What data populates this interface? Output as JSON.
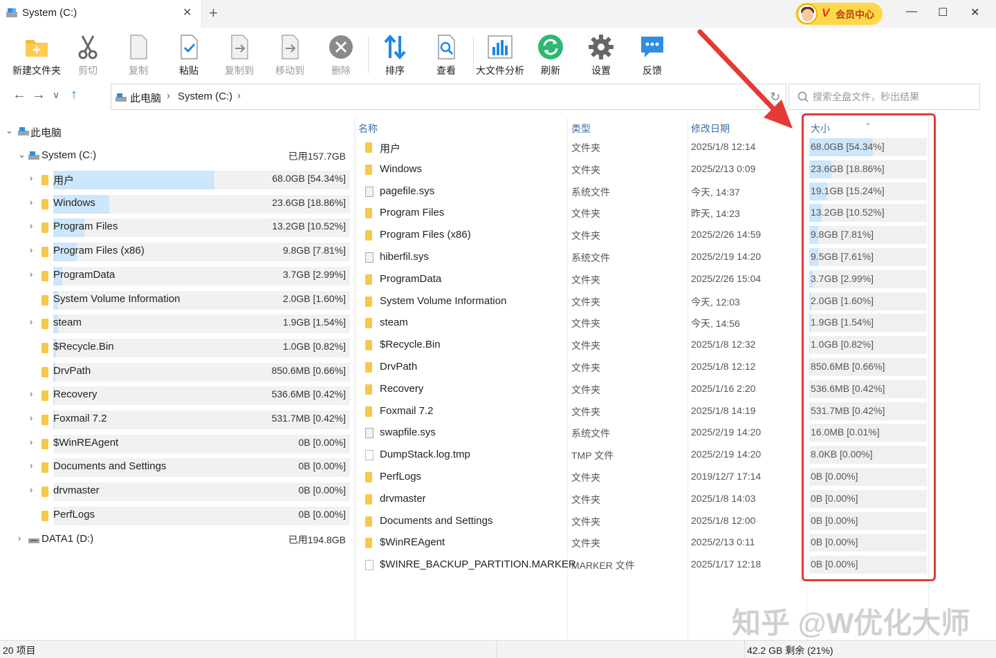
{
  "titlebar": {
    "tab_title": "System (C:)",
    "vip_badge": "V",
    "vip_label": "会员中心",
    "colors": {
      "vip_bg": "#ffd84a",
      "vip_text": "#b8420c"
    }
  },
  "toolbar": {
    "items": [
      {
        "label": "新建文件夹",
        "icon": "new-folder-icon",
        "enabled": true
      },
      {
        "label": "剪切",
        "icon": "scissors-icon",
        "enabled": false
      },
      {
        "label": "复制",
        "icon": "copy-icon",
        "enabled": false
      },
      {
        "label": "粘贴",
        "icon": "paste-icon",
        "enabled": true
      },
      {
        "label": "复制到",
        "icon": "copy-to-icon",
        "enabled": false
      },
      {
        "label": "移动到",
        "icon": "move-to-icon",
        "enabled": false
      },
      {
        "label": "删除",
        "icon": "delete-icon",
        "enabled": false
      },
      {
        "label": "排序",
        "icon": "sort-icon",
        "enabled": true
      },
      {
        "label": "查看",
        "icon": "view-icon",
        "enabled": true
      },
      {
        "label": "大文件分析",
        "icon": "chart-icon",
        "enabled": true
      },
      {
        "label": "刷新",
        "icon": "refresh-icon",
        "enabled": true
      },
      {
        "label": "设置",
        "icon": "gear-icon",
        "enabled": true
      },
      {
        "label": "反馈",
        "icon": "feedback-icon",
        "enabled": true
      }
    ]
  },
  "nav": {
    "breadcrumb": [
      "此电脑",
      "System (C:)"
    ],
    "search_placeholder": "搜索全盘文件，秒出结果"
  },
  "tree": {
    "root": "此电脑",
    "drive_c": {
      "label": "System (C:)",
      "used": "已用157.7GB"
    },
    "items": [
      {
        "name": "用户",
        "size": "68.0GB [54.34%]",
        "pct": 54.34,
        "expandable": true
      },
      {
        "name": "Windows",
        "size": "23.6GB [18.86%]",
        "pct": 18.86,
        "expandable": true
      },
      {
        "name": "Program Files",
        "size": "13.2GB [10.52%]",
        "pct": 10.52,
        "expandable": true
      },
      {
        "name": "Program Files (x86)",
        "size": "9.8GB [7.81%]",
        "pct": 7.81,
        "expandable": true
      },
      {
        "name": "ProgramData",
        "size": "3.7GB [2.99%]",
        "pct": 2.99,
        "expandable": true
      },
      {
        "name": "System Volume Information",
        "size": "2.0GB [1.60%]",
        "pct": 1.6,
        "expandable": false
      },
      {
        "name": "steam",
        "size": "1.9GB [1.54%]",
        "pct": 1.54,
        "expandable": true
      },
      {
        "name": "$Recycle.Bin",
        "size": "1.0GB [0.82%]",
        "pct": 0.82,
        "expandable": false
      },
      {
        "name": "DrvPath",
        "size": "850.6MB [0.66%]",
        "pct": 0.66,
        "expandable": false
      },
      {
        "name": "Recovery",
        "size": "536.6MB [0.42%]",
        "pct": 0.42,
        "expandable": true
      },
      {
        "name": "Foxmail 7.2",
        "size": "531.7MB [0.42%]",
        "pct": 0.42,
        "expandable": true
      },
      {
        "name": "$WinREAgent",
        "size": "0B [0.00%]",
        "pct": 0,
        "expandable": true
      },
      {
        "name": "Documents and Settings",
        "size": "0B [0.00%]",
        "pct": 0,
        "expandable": true
      },
      {
        "name": "drvmaster",
        "size": "0B [0.00%]",
        "pct": 0,
        "expandable": true
      },
      {
        "name": "PerfLogs",
        "size": "0B [0.00%]",
        "pct": 0,
        "expandable": false
      }
    ],
    "drive_d": {
      "label": "DATA1 (D:)",
      "used": "已用194.8GB"
    }
  },
  "list": {
    "headers": {
      "name": "名称",
      "type": "类型",
      "date": "修改日期",
      "size": "大小"
    },
    "rows": [
      {
        "name": "用户",
        "type": "文件夹",
        "date": "2025/1/8 12:14",
        "size": "68.0GB [54.34%]",
        "pct": 54.34,
        "kind": "folder"
      },
      {
        "name": "Windows",
        "type": "文件夹",
        "date": "2025/2/13 0:09",
        "size": "23.6GB [18.86%]",
        "pct": 18.86,
        "kind": "folder"
      },
      {
        "name": "pagefile.sys",
        "type": "系统文件",
        "date": "今天, 14:37",
        "size": "19.1GB [15.24%]",
        "pct": 15.24,
        "kind": "sys"
      },
      {
        "name": "Program Files",
        "type": "文件夹",
        "date": "昨天, 14:23",
        "size": "13.2GB [10.52%]",
        "pct": 10.52,
        "kind": "folder"
      },
      {
        "name": "Program Files (x86)",
        "type": "文件夹",
        "date": "2025/2/26 14:59",
        "size": "9.8GB [7.81%]",
        "pct": 7.81,
        "kind": "folder"
      },
      {
        "name": "hiberfil.sys",
        "type": "系统文件",
        "date": "2025/2/19 14:20",
        "size": "9.5GB [7.61%]",
        "pct": 7.61,
        "kind": "sys"
      },
      {
        "name": "ProgramData",
        "type": "文件夹",
        "date": "2025/2/26 15:04",
        "size": "3.7GB [2.99%]",
        "pct": 2.99,
        "kind": "folder"
      },
      {
        "name": "System Volume Information",
        "type": "文件夹",
        "date": "今天, 12:03",
        "size": "2.0GB [1.60%]",
        "pct": 1.6,
        "kind": "folder"
      },
      {
        "name": "steam",
        "type": "文件夹",
        "date": "今天, 14:56",
        "size": "1.9GB [1.54%]",
        "pct": 1.54,
        "kind": "folder"
      },
      {
        "name": "$Recycle.Bin",
        "type": "文件夹",
        "date": "2025/1/8 12:32",
        "size": "1.0GB [0.82%]",
        "pct": 0.82,
        "kind": "folder"
      },
      {
        "name": "DrvPath",
        "type": "文件夹",
        "date": "2025/1/8 12:12",
        "size": "850.6MB [0.66%]",
        "pct": 0.66,
        "kind": "folder"
      },
      {
        "name": "Recovery",
        "type": "文件夹",
        "date": "2025/1/16 2:20",
        "size": "536.6MB [0.42%]",
        "pct": 0.42,
        "kind": "folder"
      },
      {
        "name": "Foxmail 7.2",
        "type": "文件夹",
        "date": "2025/1/8 14:19",
        "size": "531.7MB [0.42%]",
        "pct": 0.42,
        "kind": "folder"
      },
      {
        "name": "swapfile.sys",
        "type": "系统文件",
        "date": "2025/2/19 14:20",
        "size": "16.0MB [0.01%]",
        "pct": 0.01,
        "kind": "sys"
      },
      {
        "name": "DumpStack.log.tmp",
        "type": "TMP 文件",
        "date": "2025/2/19 14:20",
        "size": "8.0KB [0.00%]",
        "pct": 0,
        "kind": "file"
      },
      {
        "name": "PerfLogs",
        "type": "文件夹",
        "date": "2019/12/7 17:14",
        "size": "0B [0.00%]",
        "pct": 0,
        "kind": "folder"
      },
      {
        "name": "drvmaster",
        "type": "文件夹",
        "date": "2025/1/8 14:03",
        "size": "0B [0.00%]",
        "pct": 0,
        "kind": "folder"
      },
      {
        "name": "Documents and Settings",
        "type": "文件夹",
        "date": "2025/1/8 12:00",
        "size": "0B [0.00%]",
        "pct": 0,
        "kind": "folder"
      },
      {
        "name": "$WinREAgent",
        "type": "文件夹",
        "date": "2025/2/13 0:11",
        "size": "0B [0.00%]",
        "pct": 0,
        "kind": "folder"
      },
      {
        "name": "$WINRE_BACKUP_PARTITION.MARKER",
        "type": "MARKER 文件",
        "date": "2025/1/17 12:18",
        "size": "0B [0.00%]",
        "pct": 0,
        "kind": "file"
      }
    ]
  },
  "watermark": "知乎 @W优化大师",
  "status": {
    "count": "20 项目",
    "free": "42.2 GB 剩余 (21%)"
  },
  "colors": {
    "accent": "#1e88e5",
    "bar_fill": "#cce6fb",
    "folder": "#f7c948",
    "annotation": "#e53935"
  }
}
